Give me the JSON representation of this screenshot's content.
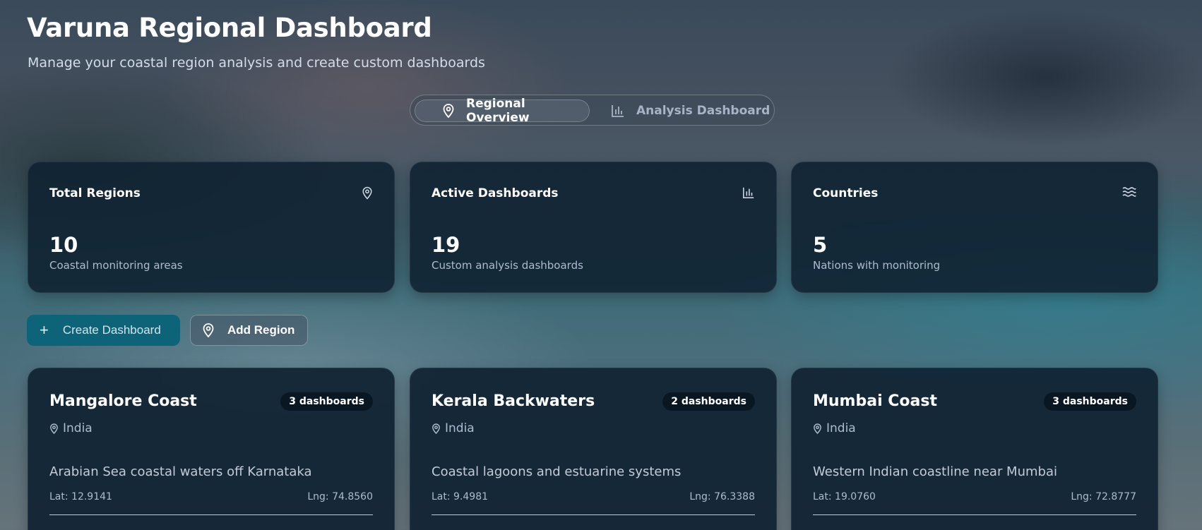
{
  "header": {
    "title": "Varuna Regional Dashboard",
    "subtitle": "Manage your coastal region analysis and create custom dashboards"
  },
  "view_toggle": {
    "tabs": [
      {
        "label": "Regional Overview",
        "icon": "map-pin-icon",
        "active": true
      },
      {
        "label": "Analysis Dashboard",
        "icon": "bar-chart-icon",
        "active": false
      }
    ]
  },
  "stats": [
    {
      "label": "Total Regions",
      "value": "10",
      "description": "Coastal monitoring areas",
      "icon": "map-pin-icon"
    },
    {
      "label": "Active Dashboards",
      "value": "19",
      "description": "Custom analysis dashboards",
      "icon": "bar-chart-icon"
    },
    {
      "label": "Countries",
      "value": "5",
      "description": "Nations with monitoring",
      "icon": "waves-icon"
    }
  ],
  "actions": {
    "create_label": "Create Dashboard",
    "create_icon": "plus-icon",
    "add_region_label": "Add Region",
    "add_region_icon": "map-pin-icon"
  },
  "regions": [
    {
      "name": "Mangalore Coast",
      "badge": "3 dashboards",
      "country": "India",
      "description": "Arabian Sea coastal waters off Karnataka",
      "lat": "Lat: 12.9141",
      "lng": "Lng: 74.8560"
    },
    {
      "name": "Kerala Backwaters",
      "badge": "2 dashboards",
      "country": "India",
      "description": "Coastal lagoons and estuarine systems",
      "lat": "Lat: 9.4981",
      "lng": "Lng: 76.3388"
    },
    {
      "name": "Mumbai Coast",
      "badge": "3 dashboards",
      "country": "India",
      "description": "Western Indian coastline near Mumbai",
      "lat": "Lat: 19.0760",
      "lng": "Lng: 72.8777"
    }
  ],
  "colors": {
    "card_bg": "#0f2232",
    "accent_button": "#0d6378",
    "text_muted": "#aebbd0"
  }
}
